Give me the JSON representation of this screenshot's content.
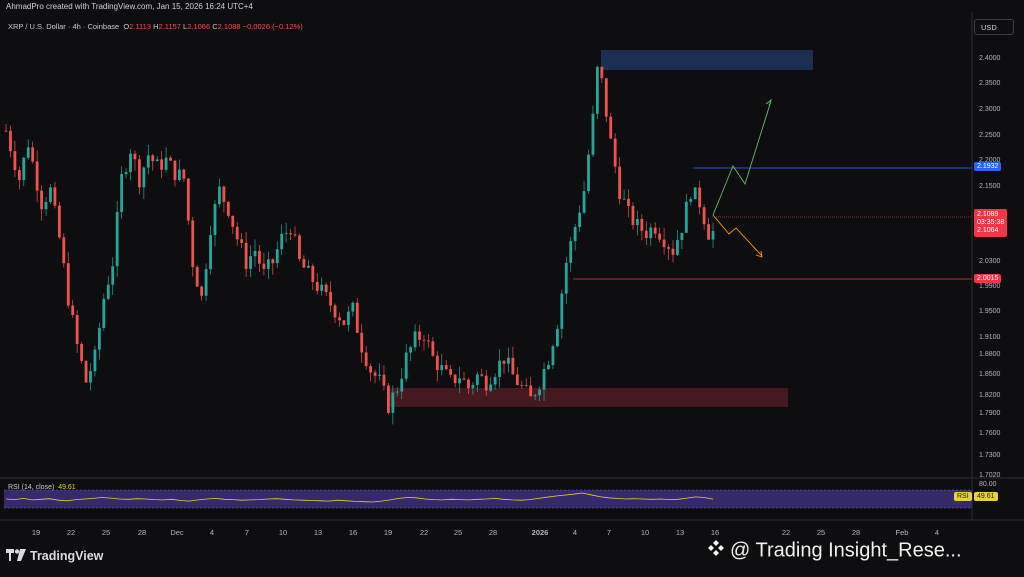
{
  "header": {
    "text": "AhmadPro created with TradingView.com, Jan 15, 2026 16:24 UTC+4"
  },
  "legend": {
    "symbol": "XRP / U.S. Dollar · 4h · Coinbase",
    "ohlc": [
      {
        "k": "O",
        "v": "2.1113"
      },
      {
        "k": "H",
        "v": "2.1157"
      },
      {
        "k": "L",
        "v": "2.1066"
      },
      {
        "k": "C",
        "v": "2.1088"
      }
    ],
    "change": "−0.0026 (−0.12%)"
  },
  "currency_button": "USD",
  "price_axis": [
    "2.4000",
    "2.3500",
    "2.3000",
    "2.2500",
    "2.2000",
    "2.1500",
    "2.0300",
    "1.9900",
    "1.9500",
    "1.9100",
    "1.8800",
    "1.8500",
    "1.8200",
    "1.7900",
    "1.7600",
    "1.7300",
    "1.7020"
  ],
  "price_tags": {
    "level_high": "2.1932",
    "last_price": "2.1089",
    "countdown": "03:35:38",
    "last_low": "2.1064",
    "level_low": "2.0015"
  },
  "rsi": {
    "label": "RSI (14, close)",
    "value": "49.61",
    "axis_top": "80.00",
    "tag_name": "RSI",
    "tag_value": "49.61"
  },
  "time_axis": [
    "19",
    "22",
    "25",
    "28",
    "Dec",
    "4",
    "7",
    "10",
    "13",
    "16",
    "19",
    "22",
    "25",
    "28",
    "2026",
    "4",
    "7",
    "10",
    "13",
    "16",
    "22",
    "25",
    "28",
    "Feb",
    "4"
  ],
  "footer": {
    "brand": "TradingView",
    "watermark": "@ Trading Insight_Rese..."
  },
  "colors": {
    "up": "#26a69a",
    "down": "#ef5350",
    "rsi_line": "#e5d13a",
    "rsi_band": "#4a3a8c",
    "blue_tag": "#2962ff",
    "red_tag": "#f23645"
  },
  "chart_data": {
    "type": "candlestick",
    "title": "XRP / U.S. Dollar · 4h · Coinbase",
    "ylim": [
      1.7,
      2.42
    ],
    "key_levels": [
      2.1932,
      2.0015
    ],
    "supply_zone": [
      2.38,
      2.42
    ],
    "demand_zone": [
      1.8,
      1.84
    ],
    "close_path": [
      [
        0,
        2.28
      ],
      [
        3,
        2.2
      ],
      [
        5,
        2.26
      ],
      [
        8,
        2.16
      ],
      [
        10,
        2.18
      ],
      [
        12,
        2.1
      ],
      [
        14,
        2.0
      ],
      [
        16,
        1.92
      ],
      [
        18,
        1.86
      ],
      [
        20,
        1.9
      ],
      [
        22,
        2.0
      ],
      [
        24,
        2.06
      ],
      [
        26,
        2.2
      ],
      [
        28,
        2.25
      ],
      [
        30,
        2.2
      ],
      [
        32,
        2.24
      ],
      [
        34,
        2.22
      ],
      [
        36,
        2.23
      ],
      [
        38,
        2.21
      ],
      [
        40,
        2.2
      ],
      [
        42,
        2.06
      ],
      [
        44,
        2.0
      ],
      [
        46,
        2.12
      ],
      [
        48,
        2.18
      ],
      [
        50,
        2.15
      ],
      [
        52,
        2.1
      ],
      [
        54,
        2.06
      ],
      [
        56,
        2.08
      ],
      [
        58,
        2.04
      ],
      [
        60,
        2.06
      ],
      [
        62,
        2.1
      ],
      [
        64,
        2.12
      ],
      [
        66,
        2.06
      ],
      [
        68,
        2.04
      ],
      [
        70,
        2.02
      ],
      [
        72,
        2.0
      ],
      [
        74,
        1.98
      ],
      [
        76,
        1.96
      ],
      [
        78,
        1.98
      ],
      [
        80,
        1.92
      ],
      [
        82,
        1.88
      ],
      [
        84,
        1.86
      ],
      [
        86,
        1.82
      ],
      [
        88,
        1.85
      ],
      [
        90,
        1.9
      ],
      [
        92,
        1.93
      ],
      [
        94,
        1.94
      ],
      [
        96,
        1.9
      ],
      [
        98,
        1.88
      ],
      [
        100,
        1.86
      ],
      [
        102,
        1.87
      ],
      [
        104,
        1.85
      ],
      [
        106,
        1.87
      ],
      [
        108,
        1.86
      ],
      [
        110,
        1.88
      ],
      [
        112,
        1.9
      ],
      [
        114,
        1.87
      ],
      [
        116,
        1.85
      ],
      [
        118,
        1.83
      ],
      [
        120,
        1.86
      ],
      [
        122,
        1.9
      ],
      [
        124,
        1.96
      ],
      [
        126,
        2.06
      ],
      [
        128,
        2.12
      ],
      [
        130,
        2.18
      ],
      [
        132,
        2.3
      ],
      [
        133,
        2.38
      ],
      [
        134,
        2.36
      ],
      [
        136,
        2.26
      ],
      [
        138,
        2.18
      ],
      [
        140,
        2.14
      ],
      [
        142,
        2.12
      ],
      [
        144,
        2.11
      ],
      [
        146,
        2.12
      ],
      [
        148,
        2.1
      ],
      [
        150,
        2.08
      ],
      [
        152,
        2.12
      ],
      [
        154,
        2.18
      ],
      [
        156,
        2.16
      ],
      [
        158,
        2.11
      ]
    ],
    "rsi_values": [
      50,
      48,
      52,
      47,
      49,
      51,
      46,
      44,
      48,
      50,
      52,
      55,
      53,
      50,
      49,
      51,
      50,
      48,
      47,
      49,
      45,
      43,
      47,
      50,
      52,
      49,
      48,
      46,
      47,
      48,
      50,
      51,
      49,
      47,
      46,
      45,
      44,
      43,
      46,
      44,
      42,
      41,
      40,
      43,
      47,
      52,
      55,
      54,
      50,
      48,
      47,
      49,
      48,
      47,
      49,
      50,
      52,
      49,
      47,
      46,
      48,
      52,
      56,
      60,
      63,
      66,
      70,
      64,
      58,
      54,
      52,
      50,
      51,
      50,
      49,
      50,
      48,
      49,
      53,
      57,
      55,
      49.61
    ]
  }
}
